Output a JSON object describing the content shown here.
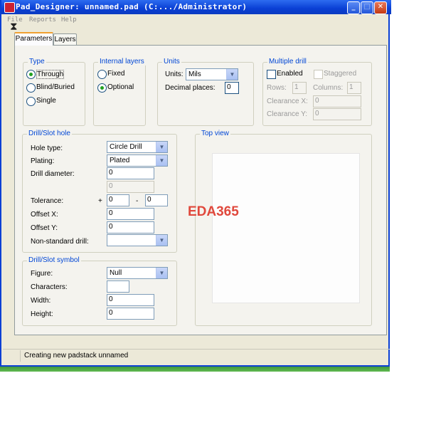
{
  "window": {
    "title": "Pad_Designer: unnamed.pad (C:.../Administrator)",
    "minimize_glyph": "_",
    "maximize_glyph": "□",
    "close_glyph": "✕"
  },
  "menu": [
    {
      "label": "File"
    },
    {
      "label": "Reports"
    },
    {
      "label": "Help"
    }
  ],
  "tabs": [
    {
      "label": "Parameters",
      "active": true
    },
    {
      "label": "Layers",
      "active": false
    }
  ],
  "type_group": {
    "title": "Type",
    "options": [
      {
        "label": "Through",
        "selected": true
      },
      {
        "label": "Blind/Buried",
        "selected": false
      },
      {
        "label": "Single",
        "selected": false
      }
    ]
  },
  "internal_layers": {
    "title": "Internal layers",
    "options": [
      {
        "label": "Fixed",
        "selected": false
      },
      {
        "label": "Optional",
        "selected": true
      }
    ]
  },
  "units": {
    "title": "Units",
    "units_label": "Units:",
    "units_value": "Mils",
    "decimal_label": "Decimal places:",
    "decimal_value": "0"
  },
  "multiple_drill": {
    "title": "Multiple drill",
    "enabled_label": "Enabled",
    "staggered_label": "Staggered",
    "rows_label": "Rows:",
    "rows_value": "1",
    "columns_label": "Columns:",
    "columns_value": "1",
    "clearance_x_label": "Clearance X:",
    "clearance_x_value": "0",
    "clearance_y_label": "Clearance Y:",
    "clearance_y_value": "0"
  },
  "drill_hole": {
    "title": "Drill/Slot hole",
    "hole_type_label": "Hole type:",
    "hole_type_value": "Circle Drill",
    "plating_label": "Plating:",
    "plating_value": "Plated",
    "drill_diameter_label": "Drill diameter:",
    "drill_diameter_value": "0",
    "drill_diameter_second": "0",
    "tolerance_label": "Tolerance:",
    "tolerance_plus": "+",
    "tolerance_plus_value": "0",
    "tolerance_minus": "-",
    "tolerance_minus_value": "0",
    "offset_x_label": "Offset X:",
    "offset_x_value": "0",
    "offset_y_label": "Offset Y:",
    "offset_y_value": "0",
    "nonstandard_label": "Non-standard drill:",
    "nonstandard_value": ""
  },
  "drill_symbol": {
    "title": "Drill/Slot symbol",
    "figure_label": "Figure:",
    "figure_value": "Null",
    "characters_label": "Characters:",
    "characters_value": "",
    "width_label": "Width:",
    "width_value": "0",
    "height_label": "Height:",
    "height_value": "0"
  },
  "top_view": {
    "title": "Top view"
  },
  "watermark": "EDA365",
  "status": {
    "message": "Creating new padstack unnamed"
  },
  "colors": {
    "title_bar": "#0a3fd4",
    "group_title": "#0046d5",
    "watermark": "#e0483c"
  }
}
